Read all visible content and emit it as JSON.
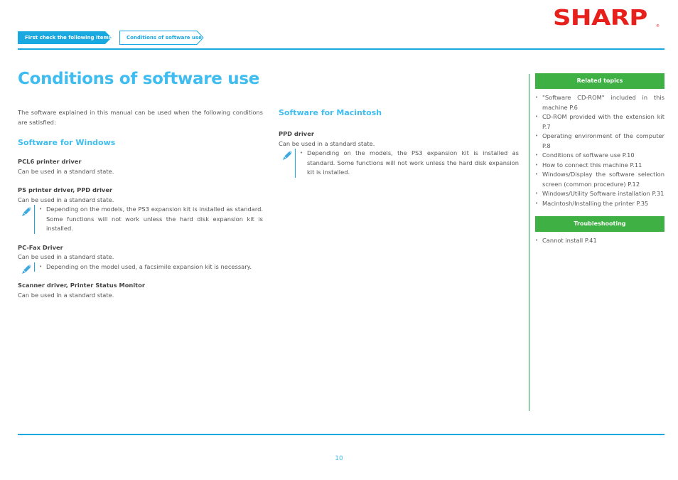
{
  "breadcrumb": {
    "items": [
      {
        "label": "First check the following items"
      },
      {
        "label": "Conditions of software use"
      }
    ]
  },
  "brand": {
    "logo_text": "SHARP",
    "registered_mark": "®",
    "color": "#e8201c"
  },
  "colors": {
    "accent": "#1aa8e0",
    "title": "#3fbdf0",
    "sidebar_header": "#3fb044",
    "sidebar_rule": "#22a050"
  },
  "page": {
    "title": "Conditions of software use",
    "intro": "The software explained in this manual can be used when the following conditions are satisfied:",
    "page_number": "10"
  },
  "windows": {
    "heading": "Software for Windows",
    "items": [
      {
        "title": "PCL6 printer driver",
        "text": "Can be used in a standard state."
      },
      {
        "title": "PS printer driver, PPD driver",
        "text": "Can be used in a standard state.",
        "note": "Depending on the models, the PS3 expansion kit is installed as standard. Some functions will not work unless the hard disk expansion kit is installed."
      },
      {
        "title": "PC-Fax Driver",
        "text": "Can be used in a standard state.",
        "note": "Depending on the model used, a facsimile expansion kit is necessary."
      },
      {
        "title": "Scanner driver, Printer Status Monitor",
        "text": "Can be used in a standard state."
      }
    ]
  },
  "macintosh": {
    "heading": "Software for Macintosh",
    "items": [
      {
        "title": "PPD driver",
        "text": "Can be used in a standard state.",
        "note": "Depending on the models, the PS3 expansion kit is installed as standard. Some functions will not work unless the hard disk expansion kit is installed."
      }
    ]
  },
  "sidebar": {
    "related": {
      "heading": "Related topics",
      "links": [
        "\"Software CD-ROM\" included in this machine P.6",
        "CD-ROM provided with the extension kit P.7",
        "Operating environment of the computer P.8",
        "Conditions of software use P.10",
        "How to connect this machine P.11",
        "Windows/Display the software selection screen (common procedure) P.12",
        "Windows/Utility Software installation P.31",
        "Macintosh/Installing the printer P.35"
      ]
    },
    "troubleshooting": {
      "heading": "Troubleshooting",
      "links": [
        "Cannot install P.41"
      ]
    }
  },
  "icons": {
    "note": "pencil-note-icon"
  }
}
